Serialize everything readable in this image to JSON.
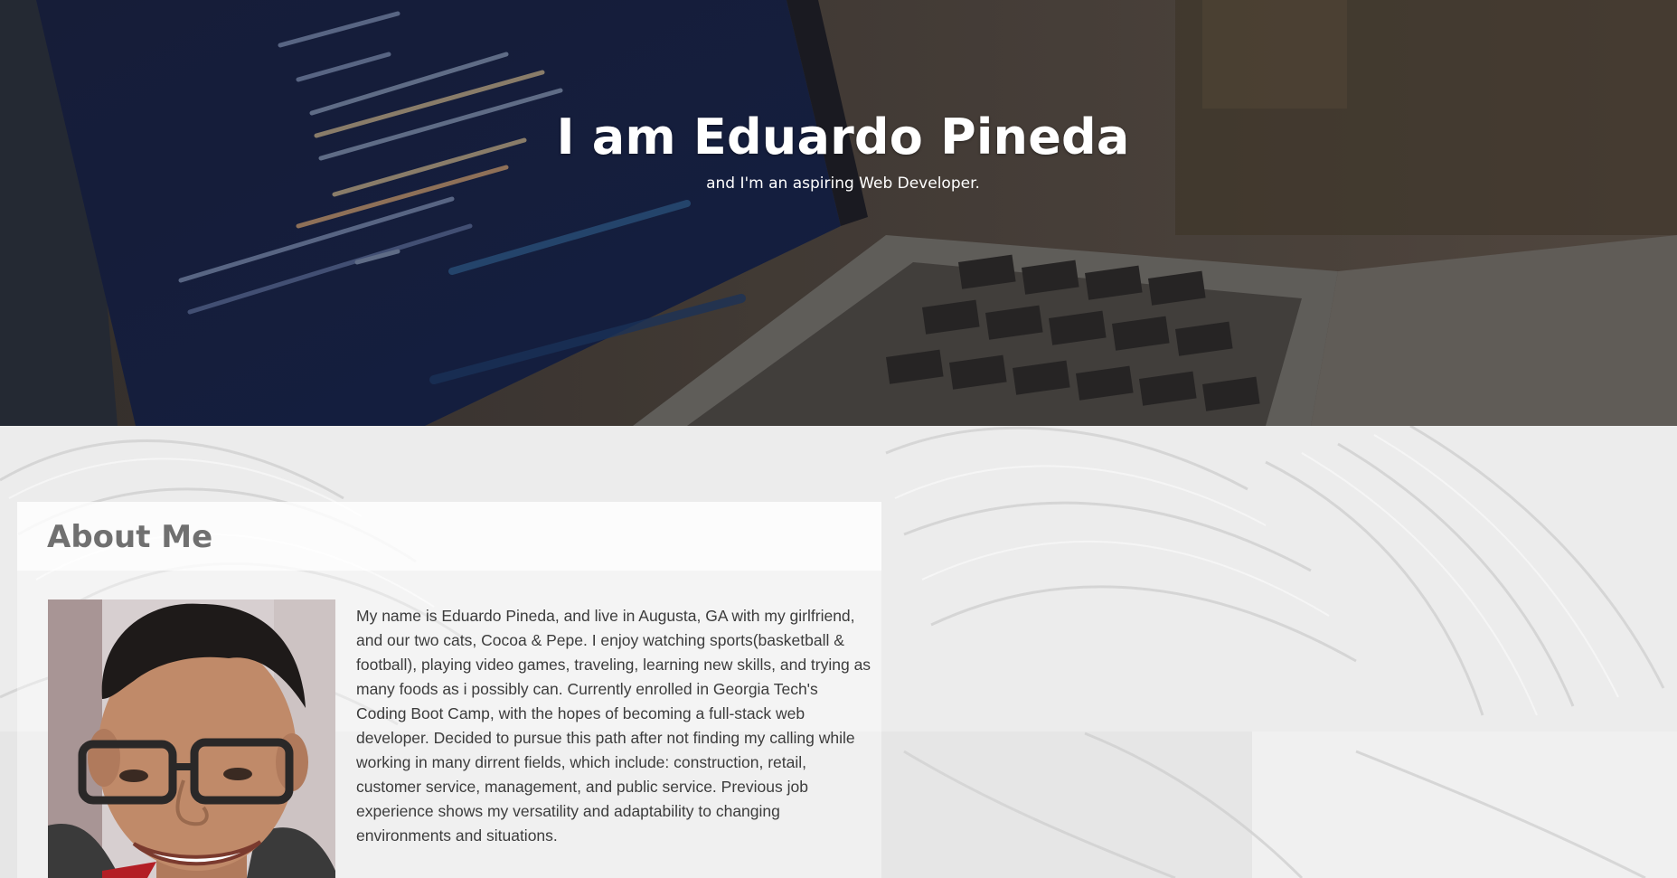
{
  "hero": {
    "title": "I am Eduardo Pineda",
    "subtitle": "and I'm an aspiring Web Developer."
  },
  "about": {
    "heading": "About Me",
    "body": "My name is Eduardo Pineda, and live in Augusta, GA with my girlfriend, and our two cats, Cocoa & Pepe. I enjoy watching sports(basketball & football), playing video games, traveling, learning new skills, and trying as many foods as i possibly can. Currently enrolled in Georgia Tech's Coding Boot Camp, with the hopes of becoming a full-stack web developer. Decided to pursue this path after not finding my calling while working in many dirrent fields, which include: construction, retail, customer service, management, and public service. Previous job experience shows my versatility and adaptability to changing environments and situations."
  },
  "colors": {
    "hero_text": "#ffffff",
    "heading_gray": "#707070",
    "body_text": "#3c3c3c"
  }
}
